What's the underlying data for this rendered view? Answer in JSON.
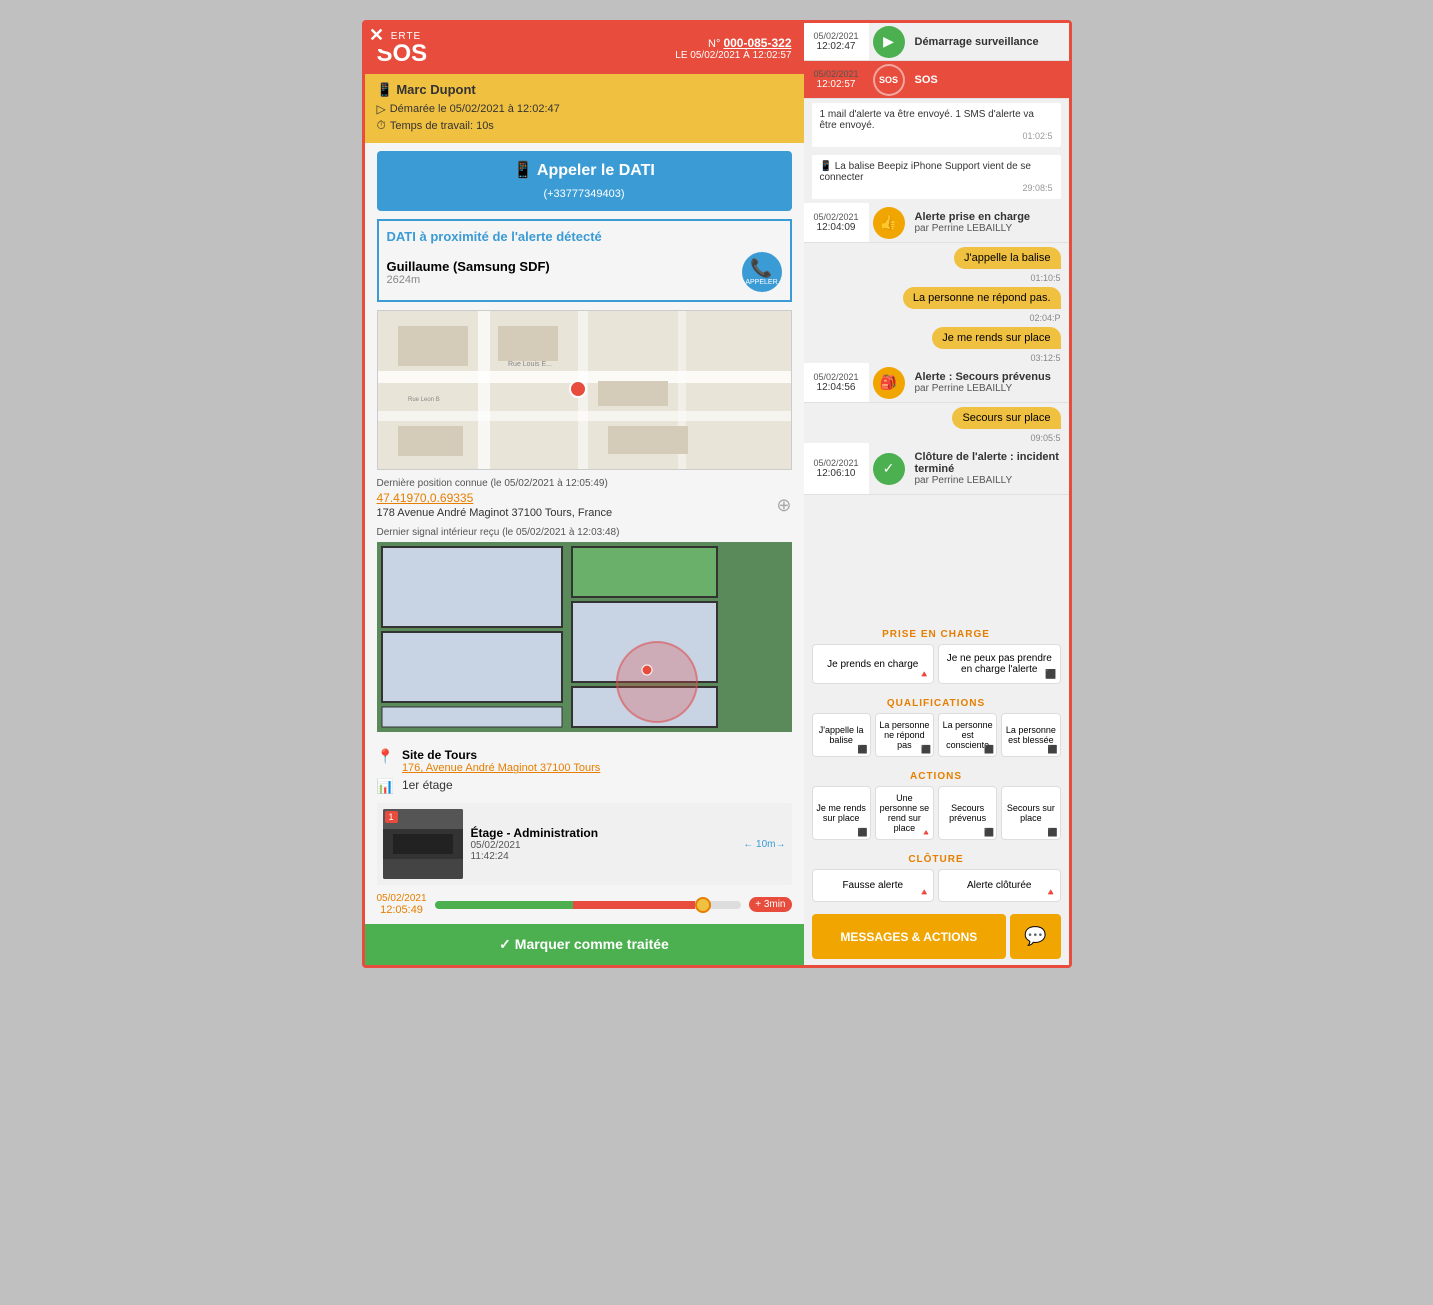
{
  "alert": {
    "label": "ALERTE",
    "sos": "SOS",
    "number_label": "N°",
    "number": "000-085-322",
    "date_label": "LE 05/02/2021 À 12:02:57"
  },
  "info_box": {
    "name": "Marc Dupont",
    "started": "Démarée le 05/02/2021 à 12:02:47",
    "work_time": "Temps de travail: 10s"
  },
  "call_dati": {
    "label": "Appeler le DATI",
    "number": "(+33777349403)"
  },
  "dati_proximity": {
    "title": "DATI à proximité de l'alerte détecté",
    "device": "Guillaume (Samsung SDF)",
    "distance": "2624m",
    "call_label": "APPELER"
  },
  "location": {
    "last_position_label": "Dernière position connue (le 05/02/2021 à 12:05:49)",
    "coords": "47.41970,0.69335",
    "address": "178 Avenue André Maginot 37100 Tours, France",
    "indoor_label": "Dernier signal intérieur reçu (le 05/02/2021 à 12:03:48)"
  },
  "site": {
    "icon": "📍",
    "name": "Site de Tours",
    "address": "176, Avenue André Maginot 37100 Tours",
    "floor_icon": "📊",
    "floor": "1er étage"
  },
  "photo": {
    "title": "Étage - Administration",
    "date": "05/02/2021",
    "time": "11:42:24",
    "wifi": "← 10m→",
    "badge": "1"
  },
  "timeline": {
    "date": "05/02/2021",
    "time": "12:05:49",
    "plus": "+ 3min"
  },
  "mark_treated": {
    "label": "✓ Marquer comme traitée"
  },
  "events": [
    {
      "date": "05/02/2021",
      "time": "12:02:47",
      "icon": "▶",
      "icon_color": "green",
      "title": "Démarrage surveillance",
      "sub": ""
    },
    {
      "date": "05/02/2021",
      "time": "12:02:57",
      "icon": "SOS",
      "icon_color": "red",
      "title": "SOS",
      "sub": ""
    },
    {
      "date": "",
      "time": "",
      "icon": "",
      "icon_color": "",
      "title": "1 mail d'alerte va être envoyé. 1 SMS d'alerte va être envoyé.",
      "sub": "",
      "type": "info"
    },
    {
      "date": "",
      "time": "",
      "icon": "📱",
      "icon_color": "",
      "title": "La balise Beepiz iPhone Support vient de se connecter",
      "sub": "",
      "type": "device"
    },
    {
      "date": "05/02/2021",
      "time": "12:04:09",
      "icon": "👍",
      "icon_color": "orange",
      "title": "Alerte prise en charge",
      "sub": "par Perrine LEBAILLY"
    }
  ],
  "messages": [
    {
      "text": "J'appelle la balise",
      "time": "01:10:5"
    },
    {
      "text": "La personne ne répond pas.",
      "time": "02:04:P"
    },
    {
      "text": "Je me rends sur place",
      "time": "03:12:5"
    }
  ],
  "events2": [
    {
      "date": "05/02/2021",
      "time": "12:04:56",
      "icon": "🎒",
      "icon_color": "orange",
      "title": "Alerte : Secours prévenus",
      "sub": "par Perrine LEBAILLY"
    },
    {
      "date": "",
      "time": "",
      "icon": "",
      "type": "bubble",
      "text": "Secours sur place"
    },
    {
      "date": "05/02/2021",
      "time": "12:06:10",
      "icon": "✓",
      "icon_color": "green",
      "title": "Clôture de l'alerte : incident terminé",
      "sub": "par Perrine LEBAILLY"
    }
  ],
  "prise_en_charge": {
    "title": "PRISE EN CHARGE",
    "btn1": "Je prends en charge",
    "btn2": "Je ne peux pas prendre en charge l'alerte"
  },
  "qualifications": {
    "title": "QUALIFICATIONS",
    "btn1": "J'appelle la balise",
    "btn2": "La personne ne répond pas",
    "btn3": "La personne est consciente",
    "btn4": "La personne est blessée"
  },
  "actions": {
    "title": "ACTIONS",
    "btn1": "Je me rends sur place",
    "btn2": "Une personne se rend sur place",
    "btn3": "Secours prévenus",
    "btn4": "Secours sur place"
  },
  "cloture": {
    "title": "CLÔTURE",
    "btn1": "Fausse alerte",
    "btn2": "Alerte clôturée"
  },
  "messages_actions": {
    "label": "MESSAGES & ACTIONS"
  }
}
